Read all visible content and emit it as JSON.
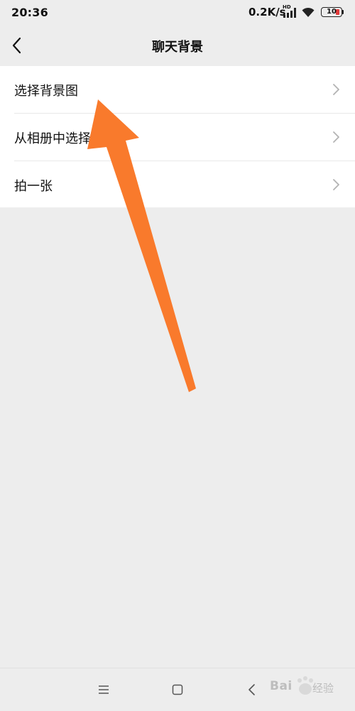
{
  "status_bar": {
    "time": "20:36",
    "network_speed": "0.2K/s",
    "hd_label": "HD",
    "battery_level": "10",
    "battery_color": "#e23b3b"
  },
  "nav": {
    "title": "聊天背景",
    "back_icon": "chevron-left-icon"
  },
  "options": [
    {
      "label": "选择背景图"
    },
    {
      "label": "从相册中选择"
    },
    {
      "label": "拍一张"
    }
  ],
  "annotation": {
    "arrow_color": "#f97a2c"
  },
  "system_nav": {
    "icons": [
      "menu-icon",
      "home-icon",
      "back-icon"
    ]
  },
  "watermark": {
    "brand": "Bai",
    "sub": "经验"
  }
}
